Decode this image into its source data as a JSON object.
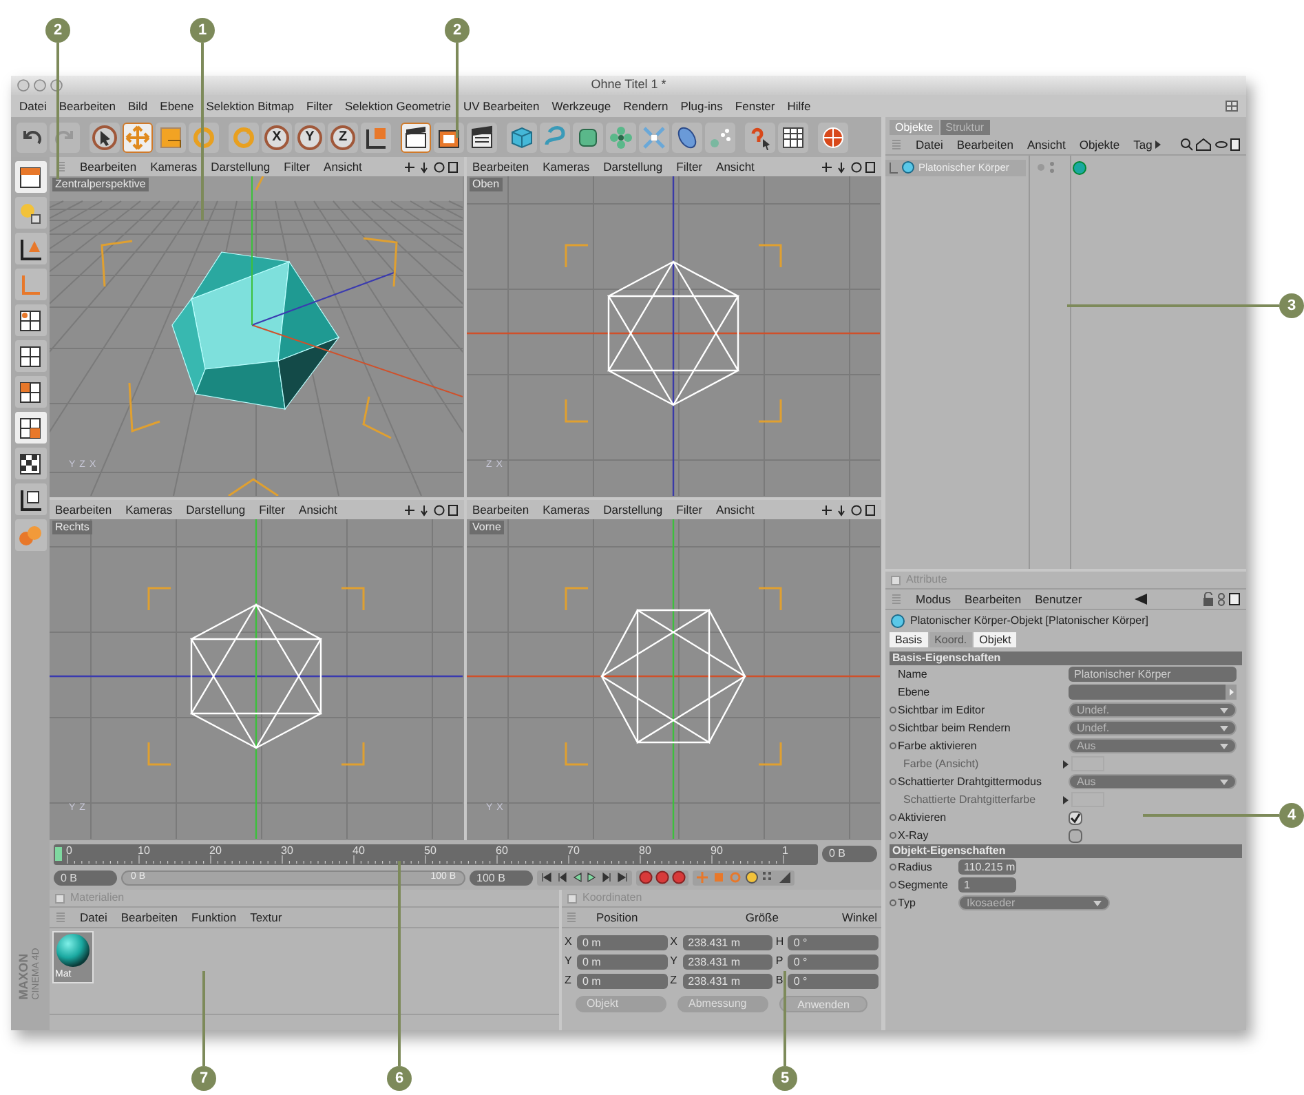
{
  "window": {
    "title": "Ohne Titel 1 *"
  },
  "menu": [
    "Datei",
    "Bearbeiten",
    "Bild",
    "Ebene",
    "Selektion Bitmap",
    "Filter",
    "Selektion Geometrie",
    "UV Bearbeiten",
    "Werkzeuge",
    "Rendern",
    "Plug-ins",
    "Fenster",
    "Hilfe"
  ],
  "toolbar": [
    {
      "kind": "undo",
      "selected": false
    },
    {
      "kind": "redo",
      "selected": false
    },
    {
      "kind": "pointer",
      "selected": false
    },
    {
      "kind": "move",
      "selected": true
    },
    {
      "kind": "scale",
      "selected": false
    },
    {
      "kind": "rotate",
      "selected": false
    },
    {
      "kind": "recent",
      "selected": false
    },
    {
      "kind": "axis",
      "label": "X",
      "selected": false
    },
    {
      "kind": "axis",
      "label": "Y",
      "selected": false
    },
    {
      "kind": "axis",
      "label": "Z",
      "selected": false
    },
    {
      "kind": "coords",
      "selected": false
    },
    {
      "kind": "render_view",
      "selected": true
    },
    {
      "kind": "render",
      "selected": false
    },
    {
      "kind": "render_settings",
      "selected": false
    },
    {
      "kind": "cube",
      "selected": false
    },
    {
      "kind": "spline",
      "selected": false
    },
    {
      "kind": "nurbs",
      "selected": false
    },
    {
      "kind": "array",
      "selected": false
    },
    {
      "kind": "deformer",
      "selected": false
    },
    {
      "kind": "scene",
      "selected": false
    },
    {
      "kind": "particles",
      "selected": false
    },
    {
      "kind": "help",
      "selected": false
    },
    {
      "kind": "timeline",
      "selected": false
    },
    {
      "kind": "globe",
      "selected": false
    }
  ],
  "viewports": [
    {
      "kind": "perspective",
      "label": "Zentralperspektive",
      "menu": [
        "Bearbeiten",
        "Kameras",
        "Darstellung",
        "Filter",
        "Ansicht"
      ],
      "gizmo_labels": [
        "Y",
        "Z",
        "X"
      ]
    },
    {
      "kind": "top",
      "label": "Oben",
      "menu": [
        "Bearbeiten",
        "Kameras",
        "Darstellung",
        "Filter",
        "Ansicht"
      ],
      "gizmo_labels": [
        "Z",
        "X"
      ]
    },
    {
      "kind": "right",
      "label": "Rechts",
      "menu": [
        "Bearbeiten",
        "Kameras",
        "Darstellung",
        "Filter",
        "Ansicht"
      ],
      "gizmo_labels": [
        "Y",
        "Z"
      ]
    },
    {
      "kind": "front",
      "label": "Vorne",
      "menu": [
        "Bearbeiten",
        "Kameras",
        "Darstellung",
        "Filter",
        "Ansicht"
      ],
      "gizmo_labels": [
        "Y",
        "X"
      ]
    }
  ],
  "timeline": {
    "ticks": [
      "0",
      "10",
      "20",
      "30",
      "40",
      "50",
      "60",
      "70",
      "80",
      "90",
      "1"
    ],
    "current_frame": "0 B",
    "start_field": "0 B",
    "range": {
      "start_label": "0 B",
      "end_label": "100 B",
      "level": 1
    },
    "end_field": "100 B"
  },
  "materials": {
    "title": "Materialien",
    "menu": [
      "Datei",
      "Bearbeiten",
      "Funktion",
      "Textur"
    ],
    "items": [
      {
        "name": "Mat"
      }
    ]
  },
  "coordinates": {
    "title": "Koordinaten",
    "headers": [
      "Position",
      "Größe",
      "Winkel"
    ],
    "rows": [
      {
        "axis": "X",
        "position": "0 m",
        "size_axis": "X",
        "size": "238.431 m",
        "angle_axis": "H",
        "angle": "0 °"
      },
      {
        "axis": "Y",
        "position": "0 m",
        "size_axis": "Y",
        "size": "238.431 m",
        "angle_axis": "P",
        "angle": "0 °"
      },
      {
        "axis": "Z",
        "position": "0 m",
        "size_axis": "Z",
        "size": "238.431 m",
        "angle_axis": "B",
        "angle": "0 °"
      }
    ],
    "dropdowns": [
      "Objekt",
      "Abmessung"
    ],
    "apply_button": "Anwenden"
  },
  "objects": {
    "tabs": [
      {
        "label": "Objekte",
        "selected": true
      },
      {
        "label": "Struktur",
        "selected": false
      }
    ],
    "menu": [
      "Datei",
      "Bearbeiten",
      "Ansicht",
      "Objekte",
      "Tag"
    ],
    "items": [
      {
        "name": "Platonischer Körper",
        "selected": true
      }
    ]
  },
  "attributes": {
    "title": "Attribute",
    "menu": [
      "Modus",
      "Bearbeiten",
      "Benutzer"
    ],
    "heading": "Platonischer Körper-Objekt [Platonischer Körper]",
    "tabs": [
      {
        "label": "Basis",
        "selected": true
      },
      {
        "label": "Koord.",
        "selected": false
      },
      {
        "label": "Objekt",
        "selected": true
      }
    ],
    "sections": [
      {
        "title": "Basis-Eigenschaften",
        "rows": [
          {
            "kind": "text",
            "label": "Name",
            "value": "Platonischer Körper",
            "anim_dot": false,
            "disabled": false
          },
          {
            "kind": "link",
            "label": "Ebene",
            "anim_dot": false,
            "disabled": false
          },
          {
            "kind": "dropdown",
            "label": "Sichtbar im Editor",
            "value": "Undef.",
            "anim_dot": true,
            "disabled": false
          },
          {
            "kind": "dropdown",
            "label": "Sichtbar beim Rendern",
            "value": "Undef.",
            "anim_dot": true,
            "disabled": false
          },
          {
            "kind": "dropdown",
            "label": "Farbe aktivieren",
            "value": "Aus",
            "anim_dot": true,
            "disabled": false
          },
          {
            "kind": "color",
            "label": "Farbe (Ansicht)",
            "anim_dot": false,
            "disabled": true
          },
          {
            "kind": "dropdown",
            "label": "Schattierter Drahtgittermodus",
            "value": "Aus",
            "anim_dot": true,
            "disabled": false
          },
          {
            "kind": "color",
            "label": "Schattierte Drahtgitterfarbe",
            "anim_dot": false,
            "disabled": true
          },
          {
            "kind": "checkbox",
            "label": "Aktivieren",
            "checked": true,
            "anim_dot": true,
            "disabled": false
          },
          {
            "kind": "checkbox",
            "label": "X-Ray",
            "checked": false,
            "anim_dot": true,
            "disabled": false
          }
        ]
      },
      {
        "title": "Objekt-Eigenschaften",
        "rows": [
          {
            "kind": "number",
            "label": "Radius",
            "value": "110.215 m",
            "anim_dot": true,
            "disabled": false
          },
          {
            "kind": "number",
            "label": "Segmente",
            "value": "1",
            "anim_dot": true,
            "disabled": false
          },
          {
            "kind": "dropdown",
            "label": "Typ",
            "value": "Ikosaeder",
            "anim_dot": true,
            "disabled": false
          }
        ]
      }
    ]
  },
  "brand": {
    "company": "MAXON",
    "product": "CINEMA 4D"
  },
  "callouts": [
    {
      "number": "2"
    },
    {
      "number": "1"
    },
    {
      "number": "2"
    },
    {
      "number": "3"
    },
    {
      "number": "4"
    },
    {
      "number": "7"
    },
    {
      "number": "6"
    },
    {
      "number": "5"
    }
  ]
}
